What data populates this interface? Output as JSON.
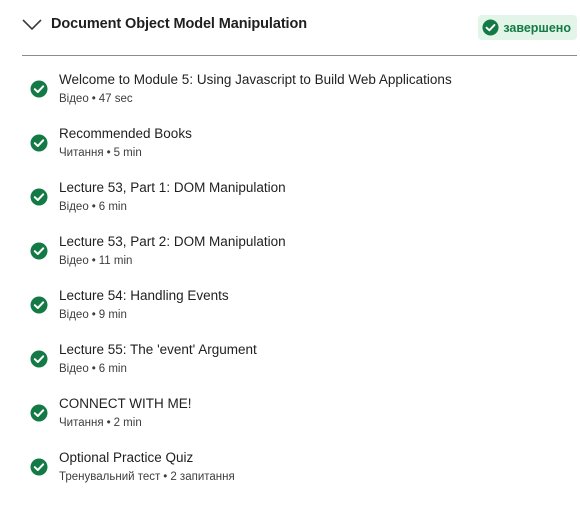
{
  "module": {
    "title": "Document Object Model Manipulation",
    "status_label": "завершено",
    "expanded_icon": "chevron-down-icon",
    "status_icon": "check-circle-icon",
    "colors": {
      "success": "#137a45",
      "badge_bg": "#e3f5e9",
      "text": "#1f1f1f",
      "meta": "#3d3d3d"
    }
  },
  "items": [
    {
      "title": "Welcome to Module 5: Using Javascript to Build Web Applications",
      "type": "Відео",
      "duration": "47 sec",
      "completed": true
    },
    {
      "title": "Recommended Books",
      "type": "Читання",
      "duration": "5 min",
      "completed": true
    },
    {
      "title": "Lecture 53, Part 1: DOM Manipulation",
      "type": "Відео",
      "duration": "6 min",
      "completed": true
    },
    {
      "title": "Lecture 53, Part 2: DOM Manipulation",
      "type": "Відео",
      "duration": "11 min",
      "completed": true
    },
    {
      "title": "Lecture 54: Handling Events",
      "type": "Відео",
      "duration": "9 min",
      "completed": true
    },
    {
      "title": "Lecture 55: The 'event' Argument",
      "type": "Відео",
      "duration": "6 min",
      "completed": true
    },
    {
      "title": "CONNECT WITH ME!",
      "type": "Читання",
      "duration": "2 min",
      "completed": true
    },
    {
      "title": "Optional Practice Quiz",
      "type": "Тренувальний тест",
      "duration": "2 запитання",
      "completed": true
    }
  ]
}
